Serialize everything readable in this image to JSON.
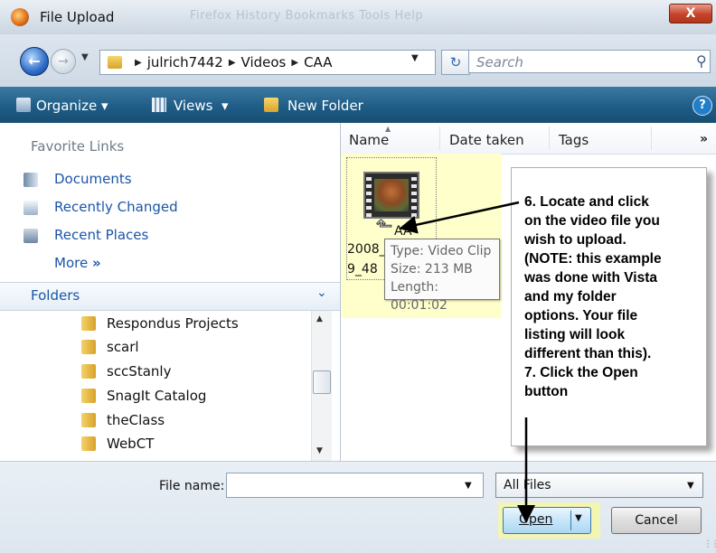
{
  "window": {
    "title": "File Upload",
    "close_label": "X",
    "background_menu": "Firefox  History  Bookmarks  Tools  Help"
  },
  "address": {
    "path": [
      "julrich7442",
      "Videos",
      "CAA"
    ],
    "search_placeholder": "Search"
  },
  "toolbar": {
    "organize": "Organize",
    "views": "Views",
    "new_folder": "New Folder",
    "help": "?"
  },
  "favorites": {
    "header": "Favorite Links",
    "items": [
      "Documents",
      "Recently Changed",
      "Recent Places"
    ],
    "more": "More"
  },
  "folders": {
    "header": "Folders",
    "items": [
      "Respondus Projects",
      "scarl",
      "sccStanly",
      "SnagIt Catalog",
      "theClass",
      "WebCT"
    ]
  },
  "columns": {
    "name": "Name",
    "date_taken": "Date taken",
    "tags": "Tags"
  },
  "file": {
    "name_line1": "2008_",
    "name_line2": "9_48",
    "name_fragment": "AA"
  },
  "tooltip": {
    "type": "Type: Video Clip",
    "size": "Size: 213 MB",
    "length": "Length: 00:01:02"
  },
  "callout": {
    "lines": [
      "6. Locate and click",
      "on the video file you",
      "wish to upload.",
      "(NOTE: this example",
      "was done with Vista",
      "and my folder",
      "options. Your file",
      "listing will look",
      "different than this).",
      "7. Click the Open",
      "button"
    ]
  },
  "bottom": {
    "file_name_label": "File name:",
    "file_name_value": "",
    "filter": "All Files",
    "open": "Open",
    "cancel": "Cancel"
  },
  "colors": {
    "toolbar": "#1f5d87",
    "link": "#1b55a8",
    "highlight": "#ffffcc"
  }
}
